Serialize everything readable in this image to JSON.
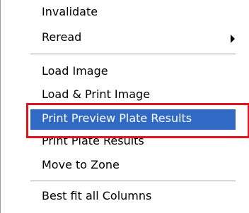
{
  "menu": {
    "items": [
      {
        "label": "Invalidate",
        "has_submenu": false,
        "highlighted": false
      },
      {
        "label": "Reread",
        "has_submenu": true,
        "highlighted": false
      },
      {
        "label": "Load Image",
        "has_submenu": false,
        "highlighted": false
      },
      {
        "label": "Load & Print Image",
        "has_submenu": false,
        "highlighted": false
      },
      {
        "label": "Print Preview Plate Results",
        "has_submenu": false,
        "highlighted": true
      },
      {
        "label": "Print Plate Results",
        "has_submenu": false,
        "highlighted": false
      },
      {
        "label": "Move to Zone",
        "has_submenu": false,
        "highlighted": false
      },
      {
        "label": "Best fit all Columns",
        "has_submenu": false,
        "highlighted": false
      }
    ]
  },
  "colors": {
    "highlight_background": "#316ac5",
    "highlight_text": "#ffffff",
    "callout_border": "#e2141e",
    "separator": "#a0a0a0"
  }
}
